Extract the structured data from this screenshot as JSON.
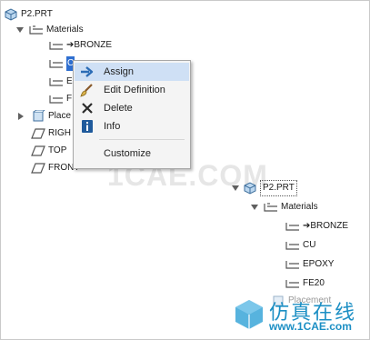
{
  "tree_main": {
    "root": "P2.PRT",
    "materials": "Materials",
    "items": [
      "➔BRONZE",
      "C",
      "E",
      "F"
    ],
    "placements": "Place",
    "planes": [
      "RIGH",
      "TOP",
      "FRONT"
    ]
  },
  "context_menu": {
    "items": [
      {
        "label": "Assign",
        "icon": "assign-arrow-icon",
        "highlighted": true
      },
      {
        "label": "Edit Definition",
        "icon": "paint-brush-icon"
      },
      {
        "label": "Delete",
        "icon": "delete-x-icon"
      },
      {
        "label": "Info",
        "icon": "info-icon"
      },
      {
        "label": "Customize",
        "icon": ""
      }
    ]
  },
  "tree_result": {
    "root": "P2.PRT",
    "materials": "Materials",
    "items": [
      "➔BRONZE",
      "CU",
      "EPOXY",
      "FE20"
    ],
    "placements": "Placement"
  },
  "watermark": "1CAE.COM",
  "brand": {
    "name": "仿真在线",
    "url": "www.1CAE.com"
  },
  "colors": {
    "accent": "#1c8fc4",
    "menu_highlight": "#cfe0f5",
    "selection": "#2f6fd0"
  }
}
